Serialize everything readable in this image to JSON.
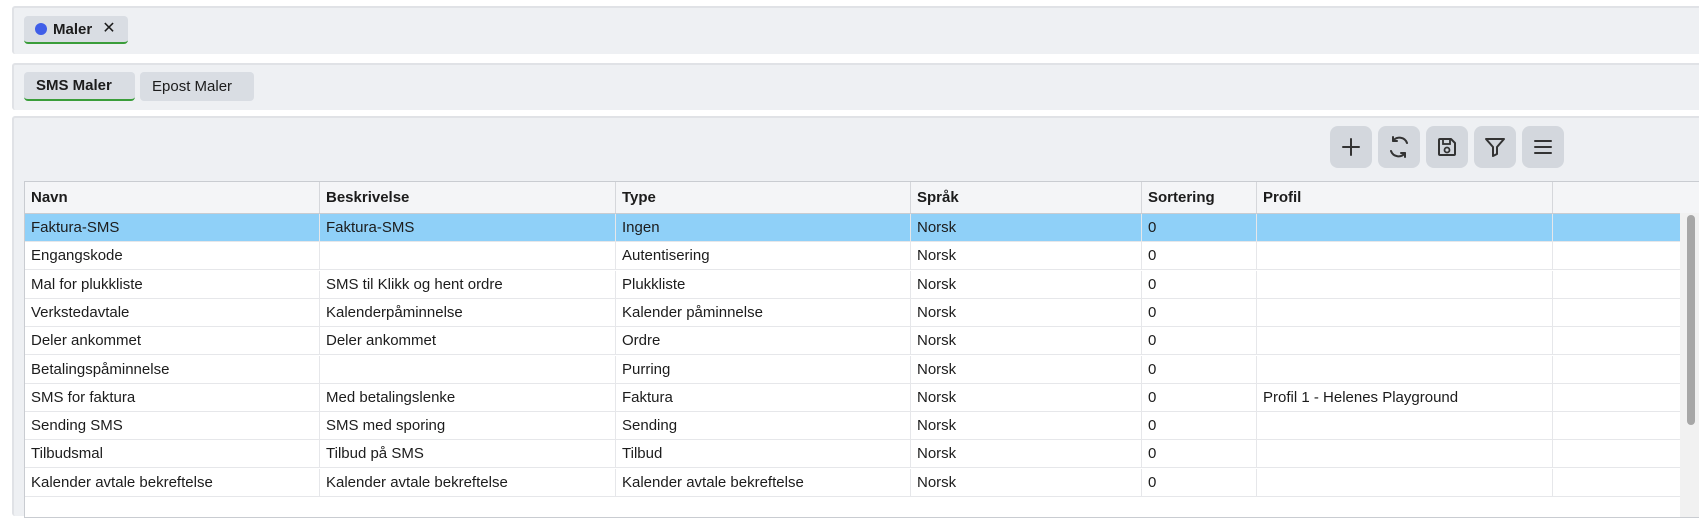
{
  "top_tabs": [
    {
      "label": "Maler",
      "dot_color": "#3f5ee8",
      "close": "✕"
    }
  ],
  "sub_tabs": [
    {
      "label": "SMS Maler",
      "active": true
    },
    {
      "label": "Epost Maler",
      "active": false
    }
  ],
  "toolbar": {
    "icons": [
      "plus-icon",
      "refresh-icon",
      "save-icon",
      "filter-icon",
      "menu-icon"
    ]
  },
  "grid": {
    "columns": [
      "Navn",
      "Beskrivelse",
      "Type",
      "Språk",
      "Sortering",
      "Profil"
    ],
    "rows": [
      [
        "Faktura-SMS",
        "Faktura-SMS",
        "Ingen",
        "Norsk",
        "0",
        ""
      ],
      [
        "Engangskode",
        "",
        "Autentisering",
        "Norsk",
        "0",
        ""
      ],
      [
        "Mal for plukkliste",
        "SMS til Klikk og hent ordre",
        "Plukkliste",
        "Norsk",
        "0",
        ""
      ],
      [
        "Verkstedavtale",
        "Kalenderpåminnelse",
        "Kalender påminnelse",
        "Norsk",
        "0",
        ""
      ],
      [
        "Deler ankommet",
        "Deler ankommet",
        "Ordre",
        "Norsk",
        "0",
        ""
      ],
      [
        "Betalingspåminnelse",
        "",
        "Purring",
        "Norsk",
        "0",
        ""
      ],
      [
        "SMS for faktura",
        "Med betalingslenke",
        "Faktura",
        "Norsk",
        "0",
        "Profil 1 - Helenes Playground"
      ],
      [
        "Sending SMS",
        "SMS med sporing",
        "Sending",
        "Norsk",
        "0",
        ""
      ],
      [
        "Tilbudsmal",
        "Tilbud på SMS",
        "Tilbud",
        "Norsk",
        "0",
        ""
      ],
      [
        "Kalender avtale bekreftelse",
        "Kalender avtale bekreftelse",
        "Kalender avtale bekreftelse",
        "Norsk",
        "0",
        ""
      ]
    ],
    "selected_row": 0,
    "selected_color": "#8fd0f8"
  }
}
